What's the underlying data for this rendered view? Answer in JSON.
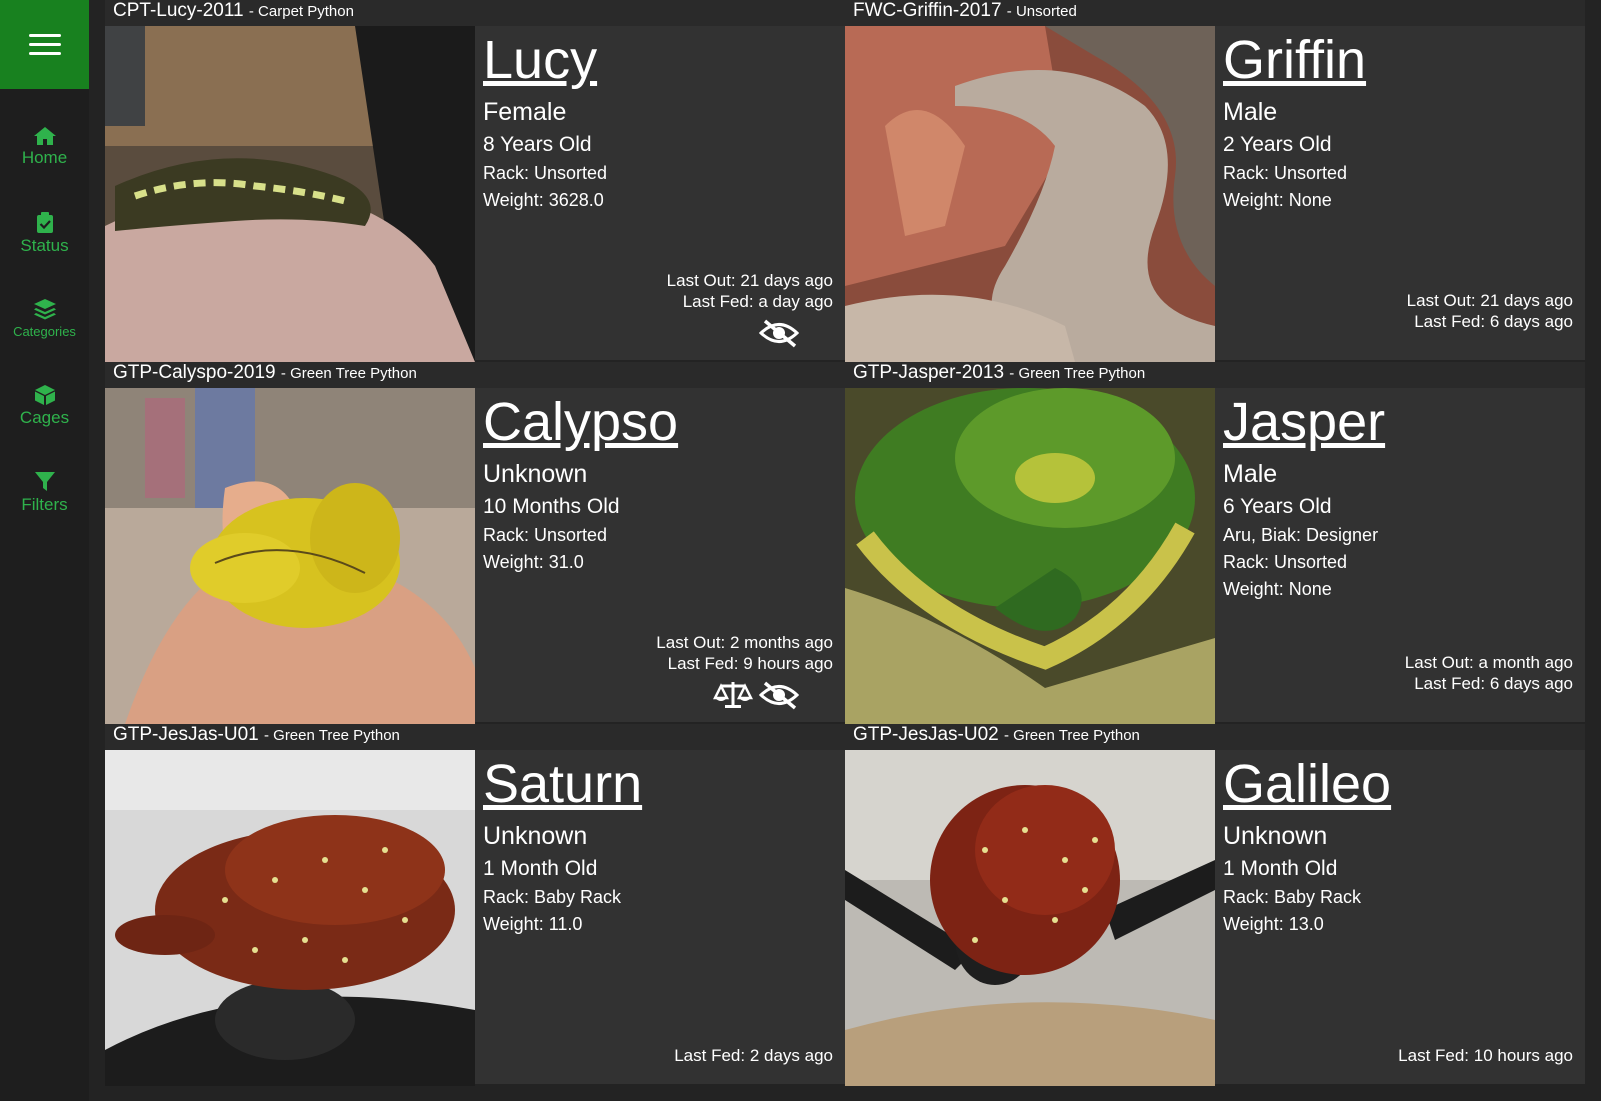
{
  "nav": {
    "menu_icon": "hamburger-icon",
    "items": [
      {
        "label": "Home",
        "icon": "home-icon"
      },
      {
        "label": "Status",
        "icon": "clipboard-check-icon"
      },
      {
        "label": "Categories",
        "icon": "layers-icon"
      },
      {
        "label": "Cages",
        "icon": "box-icon"
      },
      {
        "label": "Filters",
        "icon": "filter-icon"
      }
    ]
  },
  "colors": {
    "accent": "#18811f",
    "nav_text": "#2fb24c",
    "card_bg": "#323232",
    "page_bg": "#232323"
  },
  "cards": [
    {
      "code": "CPT-Lucy-2011",
      "species": "- Carpet Python",
      "name": "Lucy",
      "sex": "Female",
      "age": "8 Years Old",
      "extra": [],
      "rack": "Rack: Unsorted",
      "weight": "Weight: 3628.0",
      "last_out": "Last Out: 21 days ago",
      "last_fed": "Last Fed: a day ago",
      "icons": [
        "eye-slash-icon"
      ]
    },
    {
      "code": "FWC-Griffin-2017",
      "species": "- Unsorted",
      "name": "Griffin",
      "sex": "Male",
      "age": "2 Years Old",
      "extra": [],
      "rack": "Rack: Unsorted",
      "weight": "Weight: None",
      "last_out": "Last Out: 21 days ago",
      "last_fed": "Last Fed: 6 days ago",
      "icons": []
    },
    {
      "code": "GTP-Calyspo-2019",
      "species": "- Green Tree Python",
      "name": "Calypso",
      "sex": "Unknown",
      "age": "10 Months Old",
      "extra": [],
      "rack": "Rack: Unsorted",
      "weight": "Weight: 31.0",
      "last_out": "Last Out: 2 months ago",
      "last_fed": "Last Fed: 9 hours ago",
      "icons": [
        "balance-scale-icon",
        "eye-slash-icon"
      ]
    },
    {
      "code": "GTP-Jasper-2013",
      "species": "- Green Tree Python",
      "name": "Jasper",
      "sex": "Male",
      "age": "6 Years Old",
      "extra": [
        "Aru, Biak: Designer"
      ],
      "rack": "Rack: Unsorted",
      "weight": "Weight: None",
      "last_out": "Last Out: a month ago",
      "last_fed": "Last Fed: 6 days ago",
      "icons": []
    },
    {
      "code": "GTP-JesJas-U01",
      "species": "- Green Tree Python",
      "name": "Saturn",
      "sex": "Unknown",
      "age": "1 Month Old",
      "extra": [],
      "rack": "Rack: Baby Rack",
      "weight": "Weight: 11.0",
      "last_out": "",
      "last_fed": "Last Fed: 2 days ago",
      "icons": []
    },
    {
      "code": "GTP-JesJas-U02",
      "species": "- Green Tree Python",
      "name": "Galileo",
      "sex": "Unknown",
      "age": "1 Month Old",
      "extra": [],
      "rack": "Rack: Baby Rack",
      "weight": "Weight: 13.0",
      "last_out": "",
      "last_fed": "Last Fed: 10 hours ago",
      "icons": []
    }
  ]
}
